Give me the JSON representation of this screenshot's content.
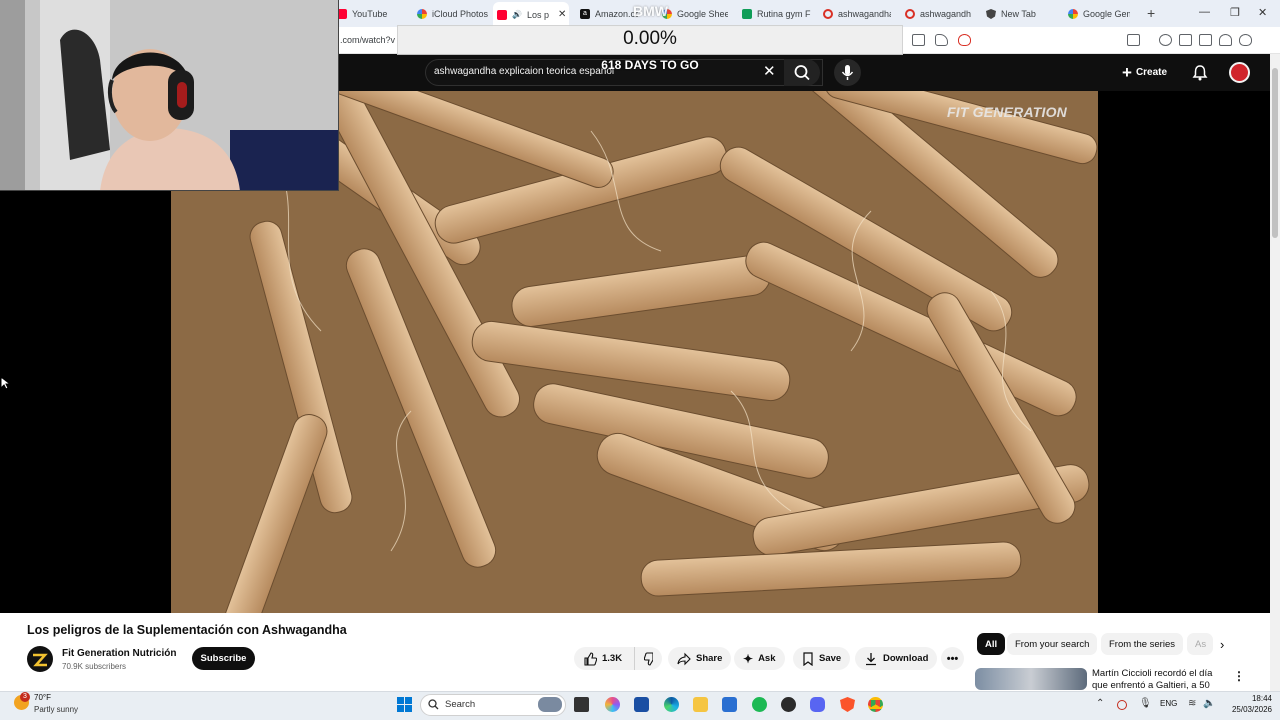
{
  "browser": {
    "tabs": [
      {
        "label": "YouTube",
        "icon": "youtube-icon",
        "color": "#ff0033"
      },
      {
        "label": "iCloud Photos",
        "icon": "google-icon",
        "color": "#4285f4"
      },
      {
        "label": "Los p",
        "icon": "youtube-icon",
        "color": "#ff0033",
        "active": true
      },
      {
        "label": "Amazon.co",
        "icon": "amazon-icon",
        "color": "#111111"
      },
      {
        "label": "Google Shee",
        "icon": "google-icon",
        "color": "#4285f4"
      },
      {
        "label": "Rutina gym F",
        "icon": "sheets-icon",
        "color": "#0f9d58"
      },
      {
        "label": "ashwagandha",
        "icon": "record-icon",
        "color": "#d93025"
      },
      {
        "label": "ashwagandha",
        "icon": "record-icon",
        "color": "#d93025"
      },
      {
        "label": "New Tab",
        "icon": "shield-icon",
        "color": "#444444"
      },
      {
        "label": "Google Gem",
        "icon": "google-icon",
        "color": "#4285f4"
      }
    ],
    "url": ".com/watch?v"
  },
  "overlay": {
    "percent": "0.00%",
    "brand": "BMW",
    "countdown": "618 DAYS TO GO"
  },
  "youtube": {
    "search_value": "ashwagandha explicaion teorica español",
    "create_label": "Create",
    "watermark": "FIT GENERATION",
    "video_title": "Los peligros de la Suplementación con Ashwagandha",
    "channel_name": "Fit Generation Nutrición",
    "channel_subs": "70.9K subscribers",
    "subscribe_label": "Subscribe",
    "likes": "1.3K",
    "share_label": "Share",
    "ask_label": "Ask",
    "save_label": "Save",
    "download_label": "Download",
    "chips": [
      "All",
      "From your search",
      "From the series",
      "As"
    ],
    "recommended_title": "Martín Ciccioli recordó el día que enfrentó a Galtieri, a 50"
  },
  "taskbar": {
    "temperature": "70°F",
    "weather": "Partly sunny",
    "weather_badge": "3",
    "search_label": "Search",
    "language": "ENG",
    "time": "18:44",
    "date": "25/03/2026"
  },
  "colors": {
    "youtube_red": "#ff0033",
    "header_bg": "#0f0f0f",
    "taskbar_bg": "#e9eef3"
  }
}
